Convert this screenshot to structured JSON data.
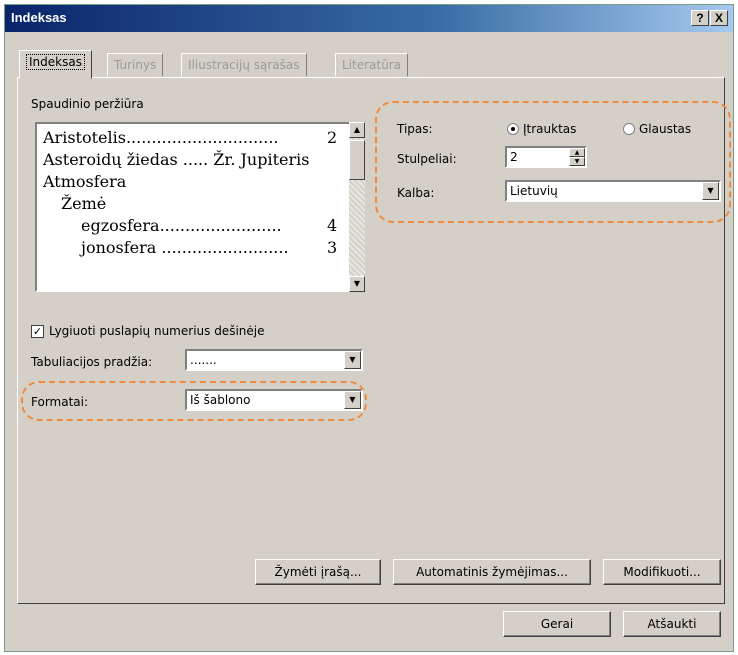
{
  "window": {
    "title": "Indeksas",
    "help_label": "?",
    "close_label": "X"
  },
  "tabs": [
    {
      "label": "Indeksas",
      "active": true
    },
    {
      "label": "Turinys",
      "active": false
    },
    {
      "label": "Iliustracijų sąrašas",
      "active": false
    },
    {
      "label": "Literatūra",
      "active": false
    }
  ],
  "preview": {
    "label": "Spaudinio peržiūra",
    "lines": [
      {
        "text": "Aristotelis..............................",
        "num": "2"
      },
      {
        "text": "Asteroidų žiedas ..... Žr. Jupiteris",
        "num": ""
      },
      {
        "text": "Atmosfera",
        "num": ""
      },
      {
        "text": "Žemė",
        "num": ""
      },
      {
        "text": "egzosfera........................",
        "num": "4"
      },
      {
        "text": "jonosfera .........................",
        "num": "3"
      }
    ]
  },
  "type": {
    "label": "Tipas:",
    "options": [
      "Įtrauktas",
      "Glaustas"
    ],
    "selected": "Įtrauktas"
  },
  "columns": {
    "label": "Stulpeliai:",
    "value": "2"
  },
  "language": {
    "label": "Kalba:",
    "value": "Lietuvių"
  },
  "align_right": {
    "label": "Lygiuoti puslapių numerius dešinėje",
    "checked": true
  },
  "tab_leader": {
    "label": "Tabuliacijos pradžia:",
    "value": "......."
  },
  "formats": {
    "label": "Formatai:",
    "value": "Iš šablono"
  },
  "buttons": {
    "mark_entry": "Žymėti įrašą...",
    "automark": "Automatinis žymėjimas...",
    "modify": "Modifikuoti...",
    "ok": "Gerai",
    "cancel": "Atšaukti"
  },
  "colors": {
    "highlight": "#f08a3c",
    "titlebar": "#0a246a"
  }
}
